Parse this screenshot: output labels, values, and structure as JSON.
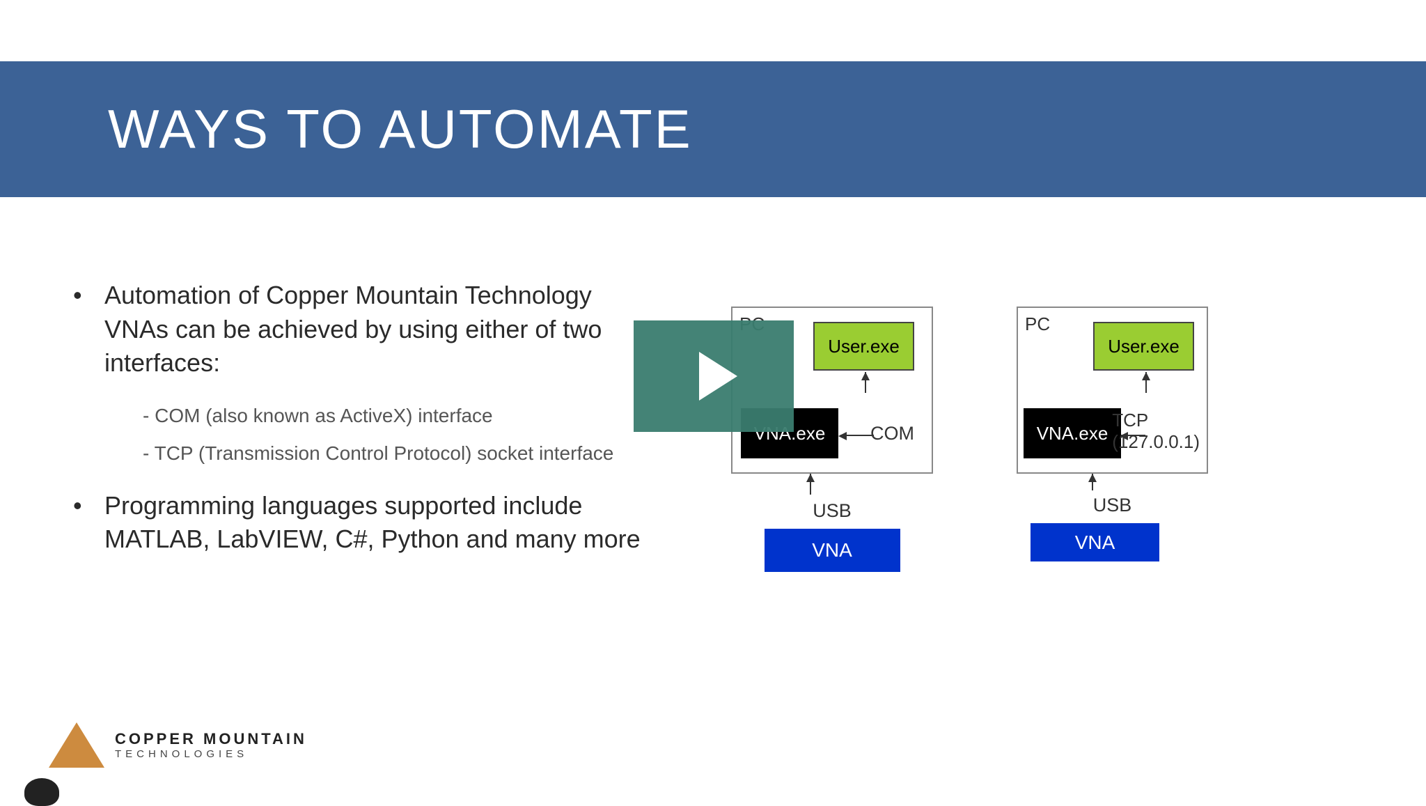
{
  "title": "WAYS TO AUTOMATE",
  "bullets": {
    "b1": "Automation of Copper Mountain Technology VNAs can be achieved by using either of two interfaces:",
    "s1": "- COM (also known as ActiveX) interface",
    "s2": "- TCP (Transmission Control Protocol) socket  interface",
    "b2": "Programming languages supported include MATLAB, LabVIEW, C#, Python and many more"
  },
  "diagram1": {
    "pc": "PC",
    "user_exe": "User.exe",
    "vna_exe": "VNA.exe",
    "conn_label": "COM",
    "usb": "USB",
    "vna": "VNA"
  },
  "diagram2": {
    "pc": "PC",
    "user_exe": "User.exe",
    "vna_exe": "VNA.exe",
    "conn_label_line1": "TCP",
    "conn_label_line2": "(127.0.0.1)",
    "usb": "USB",
    "vna": "VNA"
  },
  "footer": {
    "main": "COPPER MOUNTAIN",
    "sub": "TECHNOLOGIES"
  }
}
